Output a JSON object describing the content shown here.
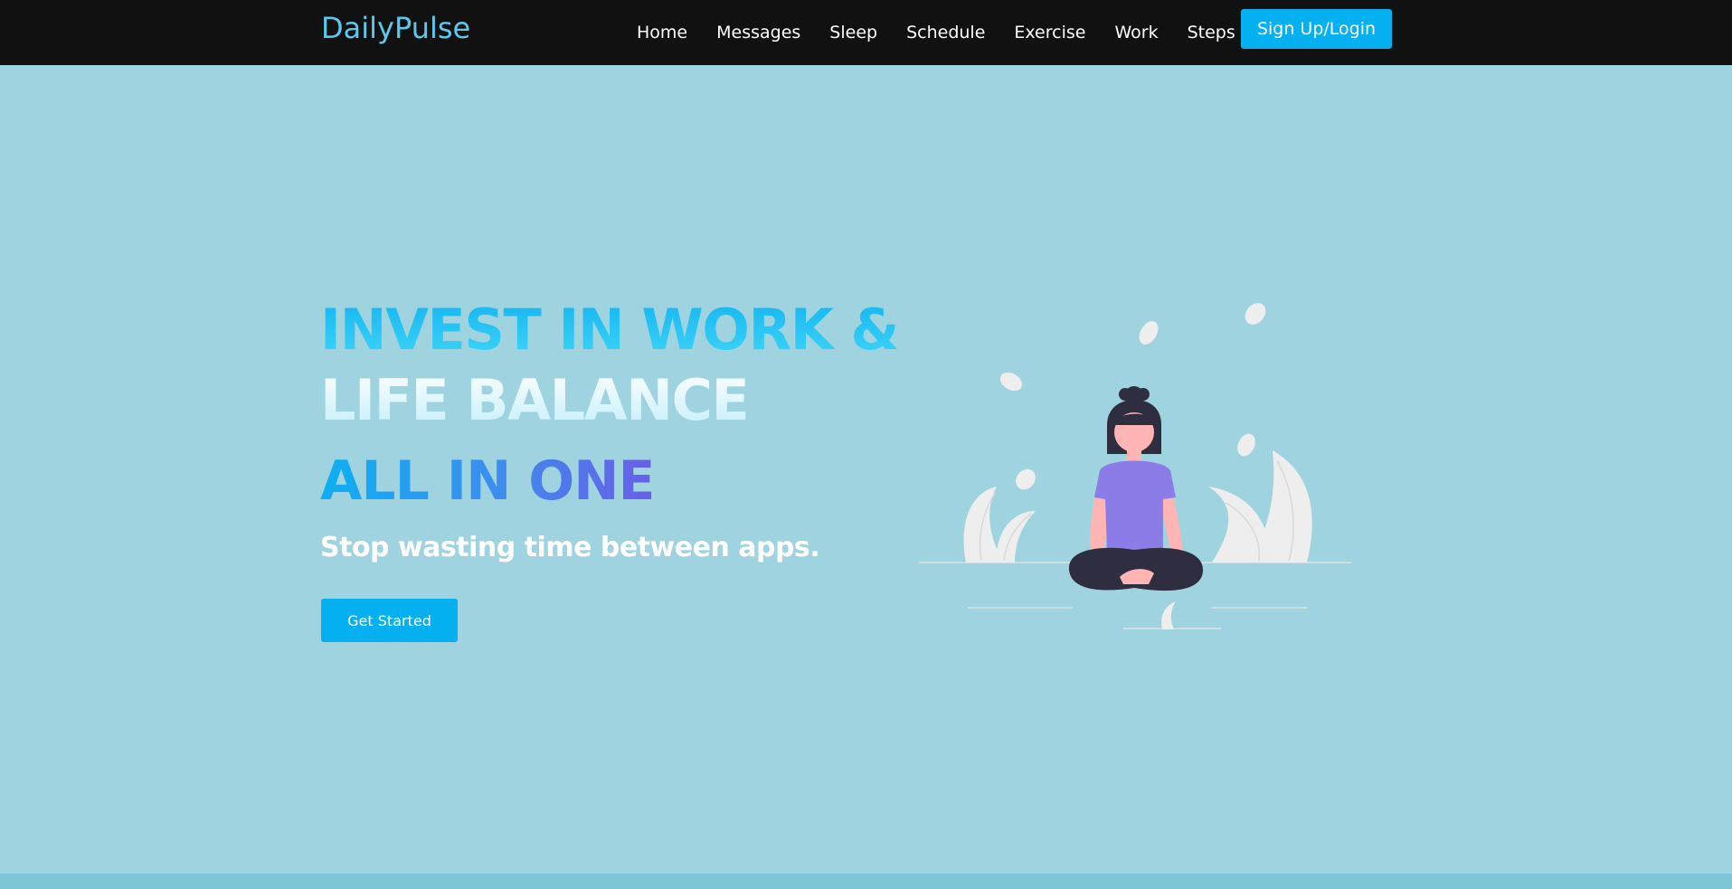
{
  "brand": {
    "name": "DailyPulse",
    "color": "#5cc9ec"
  },
  "nav": {
    "items": [
      {
        "label": "Home"
      },
      {
        "label": "Messages"
      },
      {
        "label": "Sleep"
      },
      {
        "label": "Schedule"
      },
      {
        "label": "Exercise"
      },
      {
        "label": "Work"
      },
      {
        "label": "Steps"
      }
    ],
    "signup_label": "Sign Up/Login"
  },
  "hero": {
    "line1": "INVEST IN WORK &",
    "line2": "LIFE BALANCE",
    "line3": "ALL IN ONE",
    "tagline": "Stop wasting time between apps.",
    "cta_label": "Get Started"
  },
  "colors": {
    "background": "#a0d3e0",
    "navbar": "#111111",
    "accent": "#04b0ef",
    "figure_shirt": "#8b7ce8",
    "figure_skin": "#ffb5b3",
    "figure_dark": "#2f2e41"
  },
  "illustration": {
    "icon": "meditating-woman-illustration"
  }
}
